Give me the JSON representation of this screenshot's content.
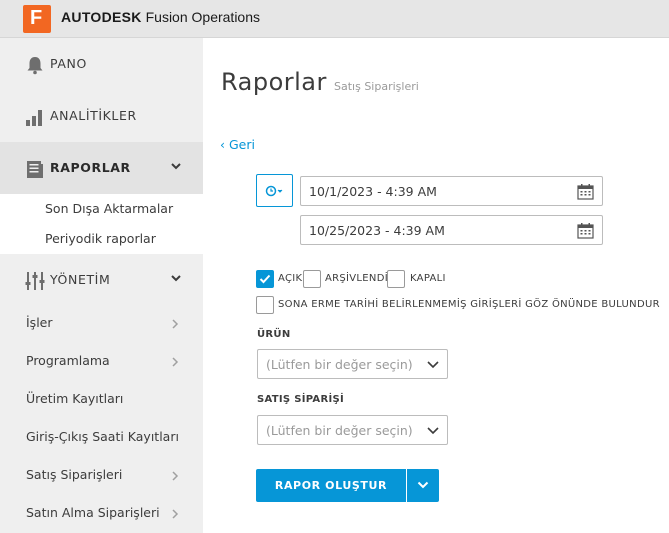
{
  "app": {
    "logo_letter": "F",
    "brand_bold": "AUTODESK",
    "brand_rest": "Fusion Operations"
  },
  "sidebar": {
    "pano": "PANO",
    "analitikler": "ANALİTİKLER",
    "raporlar": "RAPORLAR",
    "raporlar_sub": [
      "Son Dışa Aktarmalar",
      "Periyodik raporlar"
    ],
    "yonetim": "YÖNETİM",
    "items": [
      "İşler",
      "Programlama",
      "Üretim Kayıtları",
      "Giriş-Çıkış Saati Kayıtları",
      "Satış Siparişleri",
      "Satın Alma Siparişleri"
    ]
  },
  "main": {
    "title": "Raporlar",
    "subtitle": "Satış Siparişleri",
    "back": "‹ Geri",
    "date_start": "10/1/2023 - 4:39 AM",
    "date_end": "10/25/2023 - 4:39 AM",
    "status_filters": [
      {
        "label": "AÇIK",
        "checked": true
      },
      {
        "label": "ARŞİVLENDİ",
        "checked": false
      },
      {
        "label": "KAPALI",
        "checked": false
      }
    ],
    "ignore_expired_label": "SONA ERME TARİHİ BELİRLENMEMİŞ GİRİŞLERİ GÖZ ÖNÜNDE BULUNDUR",
    "product_label": "ÜRÜN",
    "product_placeholder": "(Lütfen bir değer seçin)",
    "order_label": "SATIŞ SİPARİŞİ",
    "order_placeholder": "(Lütfen bir değer seçin)",
    "generate_button": "RAPOR OLUŞTUR"
  },
  "colors": {
    "accent": "#0696d7",
    "brand_orange": "#f26722",
    "sidebar_bg": "#efefef",
    "topbar_bg": "#e6e6e6"
  }
}
